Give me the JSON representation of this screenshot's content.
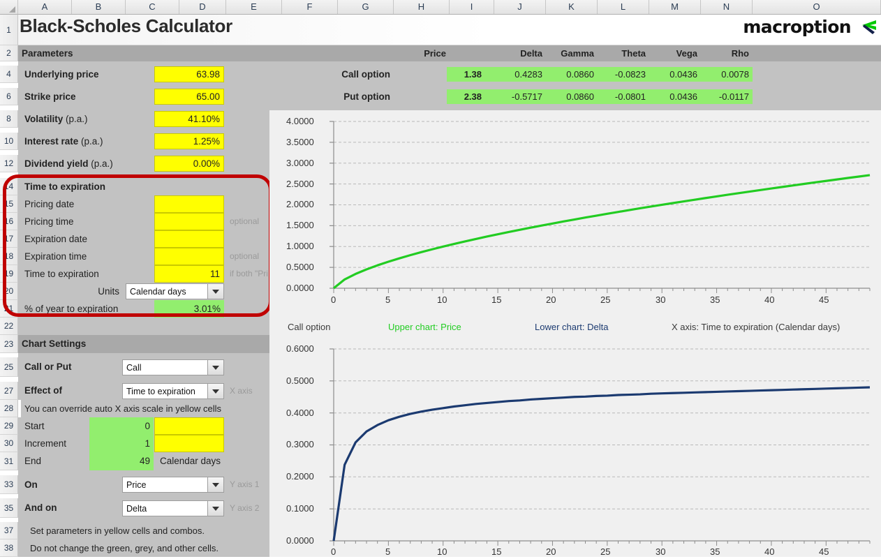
{
  "app": {
    "title": "Black-Scholes Calculator",
    "logo_text": "macroption"
  },
  "grid": {
    "columns": [
      "A",
      "B",
      "C",
      "D",
      "E",
      "F",
      "G",
      "H",
      "I",
      "J",
      "K",
      "L",
      "M",
      "N",
      "O"
    ],
    "row_numbers": [
      "1",
      "2",
      "4",
      "6",
      "8",
      "10",
      "12",
      "14",
      "15",
      "16",
      "17",
      "18",
      "19",
      "20",
      "21",
      "22",
      "23",
      "25",
      "27",
      "28",
      "29",
      "30",
      "31",
      "33",
      "35",
      "37",
      "38"
    ]
  },
  "parameters": {
    "section_label": "Parameters",
    "rows": [
      {
        "label": "Underlying price",
        "label_sub": "",
        "value": "63.98"
      },
      {
        "label": "Strike price",
        "label_sub": "",
        "value": "65.00"
      },
      {
        "label": "Volatility",
        "label_sub": " (p.a.)",
        "value": "41.10%"
      },
      {
        "label": "Interest rate",
        "label_sub": " (p.a.)",
        "value": "1.25%"
      },
      {
        "label": "Dividend yield",
        "label_sub": " (p.a.)",
        "value": "0.00%"
      }
    ]
  },
  "time_to_expiration": {
    "section_label": "Time to expiration",
    "pricing_date_label": "Pricing date",
    "pricing_date_value": "",
    "pricing_time_label": "Pricing time",
    "pricing_time_value": "",
    "pricing_time_hint": "optional",
    "expiration_date_label": "Expiration date",
    "expiration_date_value": "",
    "expiration_time_label": "Expiration time",
    "expiration_time_value": "",
    "expiration_time_hint": "optional",
    "tte_label": "Time to expiration",
    "tte_value": "11",
    "tte_hint": "if both \"Pri",
    "units_label": "Units",
    "units_value": "Calendar days",
    "pct_year_label": "% of year to expiration",
    "pct_year_value": "3.01%"
  },
  "greeks": {
    "headers": [
      "",
      "Price",
      "",
      "Delta",
      "Gamma",
      "Theta",
      "Vega",
      "Rho"
    ],
    "rows": [
      {
        "name": "Call option",
        "price": "1.38",
        "delta": "0.4283",
        "gamma": "0.0860",
        "theta": "-0.0823",
        "vega": "0.0436",
        "rho": "0.0078"
      },
      {
        "name": "Put option",
        "price": "2.38",
        "delta": "-0.5717",
        "gamma": "0.0860",
        "theta": "-0.0801",
        "vega": "0.0436",
        "rho": "-0.0117"
      }
    ]
  },
  "chart_settings": {
    "section_label": "Chart Settings",
    "call_or_put_label": "Call or Put",
    "call_or_put_value": "Call",
    "effect_of_label": "Effect of",
    "effect_of_value": "Time to expiration",
    "effect_of_hint": "X axis",
    "override_note": "You can override auto X axis scale in yellow cells",
    "start_label": "Start",
    "start_value": "0",
    "start_override": "",
    "increment_label": "Increment",
    "increment_value": "1",
    "increment_override": "",
    "end_label": "End",
    "end_value": "49",
    "end_units": "Calendar days",
    "on_label": "On",
    "on_value": "Price",
    "on_hint": "Y axis 1",
    "and_on_label": "And on",
    "and_on_value": "Delta",
    "and_on_hint": "Y axis 2",
    "note_1": "Set parameters in yellow cells and combos.",
    "note_2": "Do not change the green, grey, and other cells."
  },
  "chart_legend": {
    "option_type": "Call option",
    "upper": "Upper chart: Price",
    "lower": "Lower chart: Delta",
    "xaxis": "X axis: Time to expiration (Calendar days)"
  },
  "colors": {
    "upper_series": "#22cc22",
    "lower_series": "#1b3a70",
    "yellow_input": "#ffff00",
    "green_output": "#92ee6e",
    "annotation_ring": "#c00000"
  },
  "chart_data": [
    {
      "type": "line",
      "name": "upper-chart",
      "title": "Upper chart: Price",
      "xlabel": "X axis: Time to expiration (Calendar days)",
      "ylabel": "Price",
      "series_color": "#22cc22",
      "xlim": [
        0,
        49
      ],
      "ylim": [
        0,
        4.0
      ],
      "xticks": [
        0,
        5,
        10,
        15,
        20,
        25,
        30,
        35,
        40,
        45
      ],
      "yticks": [
        "0.0000",
        "0.5000",
        "1.0000",
        "1.5000",
        "2.0000",
        "2.5000",
        "3.0000",
        "3.5000",
        "4.0000"
      ],
      "grid": true,
      "x": [
        0,
        1,
        2,
        3,
        4,
        5,
        6,
        7,
        8,
        9,
        10,
        11,
        12,
        13,
        14,
        15,
        16,
        17,
        18,
        19,
        20,
        21,
        22,
        23,
        24,
        25,
        26,
        27,
        28,
        29,
        30,
        31,
        32,
        33,
        34,
        35,
        36,
        37,
        38,
        39,
        40,
        41,
        42,
        43,
        44,
        45,
        46,
        47,
        48,
        49
      ],
      "values": [
        0.0,
        0.211,
        0.343,
        0.452,
        0.549,
        0.636,
        0.717,
        0.793,
        0.865,
        0.933,
        0.999,
        1.062,
        1.123,
        1.182,
        1.239,
        1.294,
        1.348,
        1.401,
        1.453,
        1.503,
        1.552,
        1.601,
        1.648,
        1.695,
        1.74,
        1.786,
        1.83,
        1.874,
        1.917,
        1.959,
        2.001,
        2.042,
        2.083,
        2.123,
        2.163,
        2.202,
        2.241,
        2.279,
        2.317,
        2.355,
        2.392,
        2.429,
        2.466,
        2.502,
        2.538,
        2.573,
        2.609,
        2.644,
        2.678,
        2.713
      ]
    },
    {
      "type": "line",
      "name": "lower-chart",
      "title": "Lower chart: Delta",
      "xlabel": "X axis: Time to expiration (Calendar days)",
      "ylabel": "Delta",
      "series_color": "#1b3a70",
      "xlim": [
        0,
        49
      ],
      "ylim": [
        0,
        0.6
      ],
      "xticks": [
        0,
        5,
        10,
        15,
        20,
        25,
        30,
        35,
        40,
        45
      ],
      "yticks": [
        "0.0000",
        "0.1000",
        "0.2000",
        "0.3000",
        "0.4000",
        "0.5000",
        "0.6000"
      ],
      "grid": true,
      "x": [
        0,
        1,
        2,
        3,
        4,
        5,
        6,
        7,
        8,
        9,
        10,
        11,
        12,
        13,
        14,
        15,
        16,
        17,
        18,
        19,
        20,
        21,
        22,
        23,
        24,
        25,
        26,
        27,
        28,
        29,
        30,
        31,
        32,
        33,
        34,
        35,
        36,
        37,
        38,
        39,
        40,
        41,
        42,
        43,
        44,
        45,
        46,
        47,
        48,
        49
      ],
      "values": [
        0.0,
        0.238,
        0.308,
        0.342,
        0.362,
        0.377,
        0.388,
        0.397,
        0.404,
        0.41,
        0.415,
        0.42,
        0.424,
        0.428,
        0.431,
        0.434,
        0.437,
        0.439,
        0.442,
        0.444,
        0.446,
        0.448,
        0.45,
        0.451,
        0.453,
        0.454,
        0.456,
        0.457,
        0.458,
        0.46,
        0.461,
        0.462,
        0.463,
        0.464,
        0.465,
        0.466,
        0.467,
        0.468,
        0.469,
        0.47,
        0.471,
        0.472,
        0.473,
        0.474,
        0.475,
        0.476,
        0.477,
        0.478,
        0.479,
        0.48
      ]
    }
  ]
}
